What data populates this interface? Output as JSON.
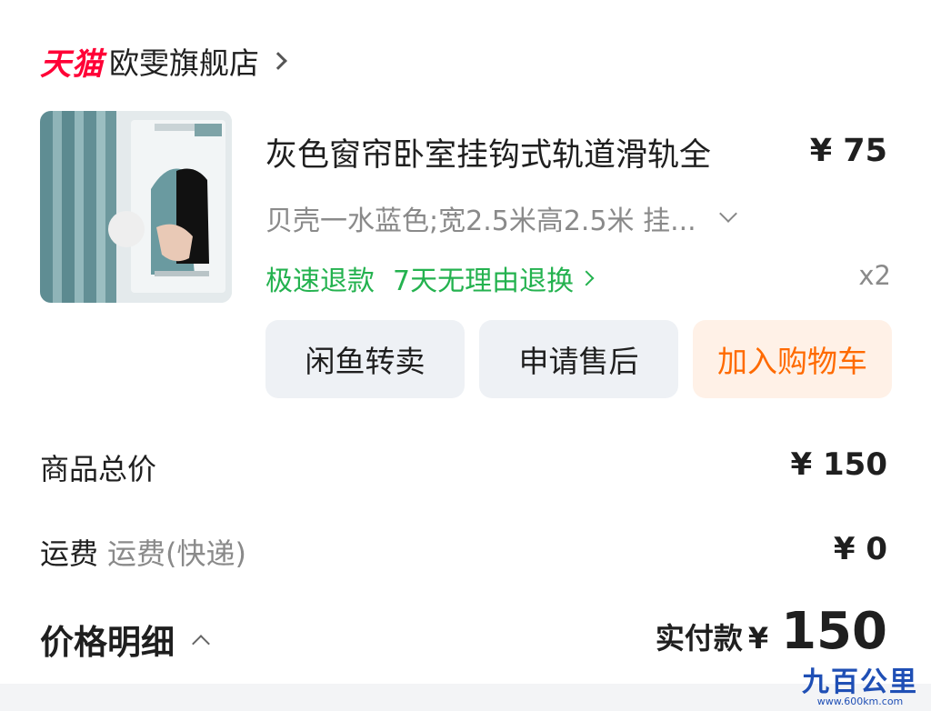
{
  "shop": {
    "platform_logo": "天猫",
    "name": "欧雯旗舰店"
  },
  "product": {
    "title": "灰色窗帘卧室挂钩式轨道滑轨全",
    "price": "¥ 75",
    "sku": "贝壳一水蓝色;宽2.5米高2.5米 挂...",
    "service_fast_refund": "极速退款",
    "service_return": "7天无理由退换",
    "quantity": "x2",
    "thumbnail_icon": "curtain-product-image"
  },
  "actions": {
    "resell": "闲鱼转卖",
    "after_sale": "申请售后",
    "add_to_cart": "加入购物车"
  },
  "summary": {
    "total_label": "商品总价",
    "total_value": "¥ 150",
    "shipping_label": "运费",
    "shipping_type": "运费(快递)",
    "shipping_value": "¥ 0",
    "detail_label": "价格明细",
    "paid_label": "实付款",
    "paid_currency": "¥",
    "paid_amount": "150"
  },
  "watermark": {
    "main": "九百公里",
    "sub": "www.600km.com"
  },
  "colors": {
    "tmall_red": "#ff0036",
    "service_green": "#24b24f",
    "cart_orange": "#ff6a00",
    "cart_bg": "#fff1e7",
    "button_gray": "#eef1f5"
  }
}
